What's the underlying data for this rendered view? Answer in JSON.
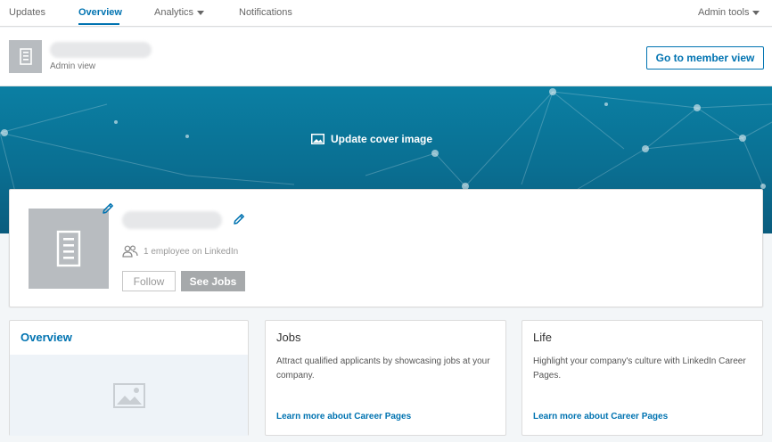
{
  "nav": {
    "tabs": [
      {
        "label": "Updates"
      },
      {
        "label": "Overview"
      },
      {
        "label": "Analytics"
      },
      {
        "label": "Notifications"
      }
    ],
    "admin_tools": "Admin tools"
  },
  "header": {
    "view_label": "Admin view",
    "member_view_button": "Go to member view"
  },
  "cover": {
    "update_label": "Update cover image"
  },
  "profile": {
    "employees_text": "1 employee on LinkedIn",
    "follow_label": "Follow",
    "see_jobs_label": "See Jobs"
  },
  "cards": {
    "overview": {
      "title": "Overview"
    },
    "jobs": {
      "title": "Jobs",
      "description": "Attract qualified applicants by showcasing jobs at your company.",
      "link": "Learn more about Career Pages"
    },
    "life": {
      "title": "Life",
      "description": "Highlight your company's culture with LinkedIn Career Pages.",
      "link": "Learn more about Career Pages"
    }
  },
  "colors": {
    "accent": "#0073b1",
    "cover": "#0a6f92",
    "placeholder": "#b8bcc0"
  }
}
